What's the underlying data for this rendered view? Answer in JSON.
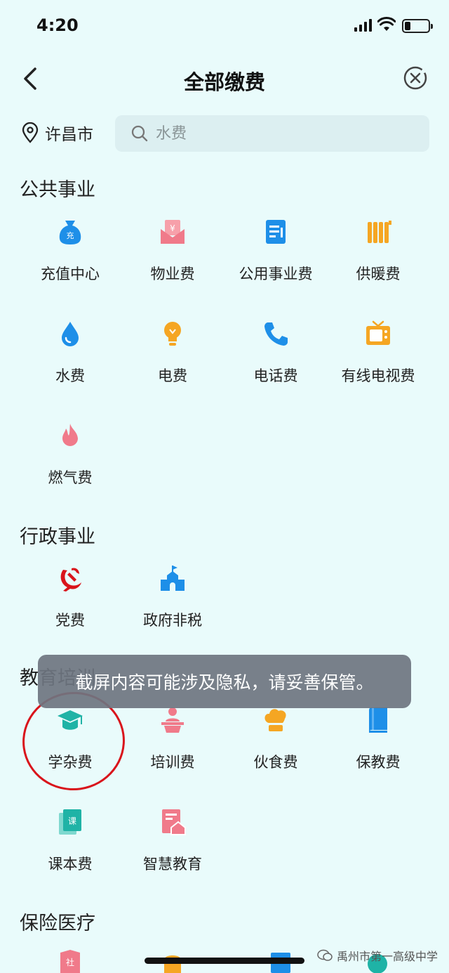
{
  "status": {
    "time": "4:20"
  },
  "nav": {
    "title": "全部缴费"
  },
  "location": {
    "city": "许昌市"
  },
  "search": {
    "placeholder": "水费"
  },
  "sections": [
    {
      "title": "公共事业",
      "items": [
        {
          "label": "充值中心",
          "icon": "recharge-bag-icon"
        },
        {
          "label": "物业费",
          "icon": "property-fee-icon"
        },
        {
          "label": "公用事业费",
          "icon": "utility-doc-icon"
        },
        {
          "label": "供暖费",
          "icon": "radiator-icon"
        },
        {
          "label": "水费",
          "icon": "water-drop-icon"
        },
        {
          "label": "电费",
          "icon": "light-bulb-icon"
        },
        {
          "label": "电话费",
          "icon": "phone-icon"
        },
        {
          "label": "有线电视费",
          "icon": "tv-icon"
        },
        {
          "label": "燃气费",
          "icon": "flame-icon"
        }
      ]
    },
    {
      "title": "行政事业",
      "items": [
        {
          "label": "党费",
          "icon": "party-emblem-icon"
        },
        {
          "label": "政府非税",
          "icon": "government-building-icon"
        }
      ]
    },
    {
      "title": "教育培训",
      "items": [
        {
          "label": "学杂费",
          "icon": "graduation-cap-icon"
        },
        {
          "label": "培训费",
          "icon": "lecturer-icon"
        },
        {
          "label": "伙食费",
          "icon": "chef-hat-icon"
        },
        {
          "label": "保教费",
          "icon": "book-icon"
        },
        {
          "label": "课本费",
          "icon": "textbook-icon"
        },
        {
          "label": "智慧教育",
          "icon": "smart-education-icon"
        }
      ]
    },
    {
      "title": "保险医疗",
      "items": []
    }
  ],
  "toast": {
    "text": "截屏内容可能涉及隐私，请妥善保管。"
  },
  "watermark": {
    "text": "禹州市第一高级中学"
  },
  "colors": {
    "background": "#E9FBFB",
    "accent_blue": "#1E8FE8",
    "pink": "#F07A8A",
    "orange": "#F5A623",
    "teal": "#1FB3A6",
    "red": "#D9141B"
  }
}
